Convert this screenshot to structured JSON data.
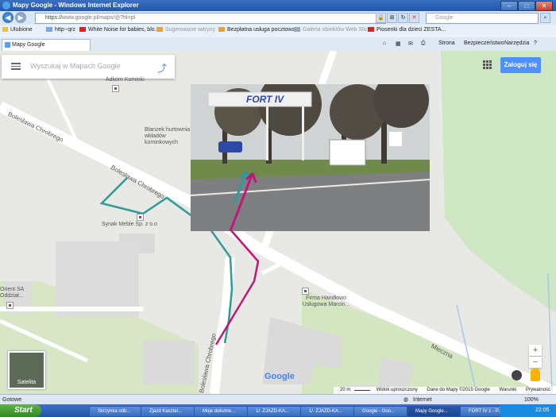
{
  "window": {
    "title": "Mapy Google - Windows Internet Explorer",
    "min": "–",
    "max": "□",
    "close": "✕"
  },
  "address": {
    "https": "https://",
    "rest": "www.google.pl/maps/@?hl=pl",
    "search_placeholder": "Google"
  },
  "favorites": {
    "label": "Ulubione",
    "items": [
      "http--qrz",
      "White Noise for babies, blo...",
      "Sugerowane witryny",
      "Bezpłatna usługa pocztowa ...",
      "Galeria obiektów Web Slice",
      "Piosenki dla dzieci ZESTA..."
    ]
  },
  "tab": {
    "label": "Mapy Google"
  },
  "commands": [
    "Strona",
    "Bezpieczeństwo",
    "Narzędzia"
  ],
  "map": {
    "search_placeholder": "Wyszukaj w Mapach Google",
    "signin": "Zaloguj się",
    "labels": {
      "adkom": "Adkom Kominki",
      "blanzek": "Blanzek hurtownia wkładów kominkowych",
      "street1": "Bolesława Chrobrego",
      "street2": "Bolesława Chrobrego",
      "street3": "Bolesława Chrobrego",
      "synak": "Synak Meble Sp. z o.o",
      "firma": "Firma Handlowo Usługowa Marcin...",
      "orient": "Orient SA Oddział...",
      "mieczna": "Mieczna"
    },
    "satellite": "Satelita",
    "google_logo": "Google",
    "zoom_in": "+",
    "zoom_out": "−",
    "footer": {
      "scale": "20 m",
      "simplified": "Widok uproszczony",
      "copyright": "Dane do Mapy ©2015 Google",
      "terms": "Warunki",
      "privacy": "Prywatność"
    },
    "photo": {
      "sign_title": "FORT IV",
      "colors": {
        "teal_route": "#2f9a9a",
        "magenta_route": "#c0187a"
      }
    }
  },
  "status": {
    "left": "Gotowe",
    "zone": "Internet",
    "zoom": "100%"
  },
  "taskbar": {
    "start": "Start",
    "buttons": [
      "Skrzynka odb...",
      "Zjazd Kasztel...",
      "Moje dokume...",
      "1/. ZJAZD-KA...",
      "1/. ZJAZD-KA...",
      "Google - Goo...",
      "Mapy Google...",
      "FORT IV 1 - P..."
    ],
    "clock": "22:05"
  }
}
